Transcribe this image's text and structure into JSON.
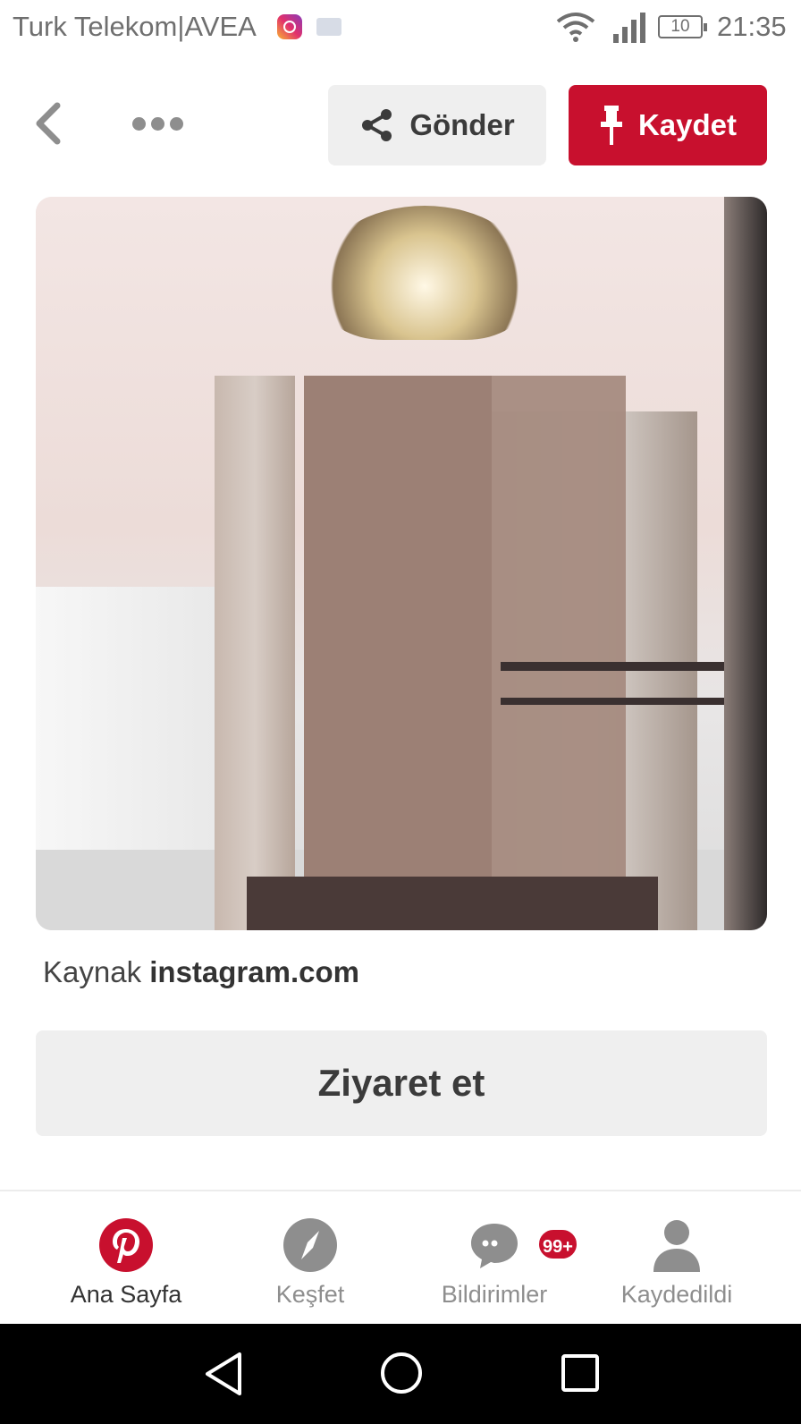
{
  "status_bar": {
    "carrier": "Turk Telekom|AVEA",
    "battery": "10",
    "time": "21:35",
    "icons": [
      "instagram-icon",
      "mail-icon",
      "wifi-icon",
      "signal-icon",
      "battery-icon"
    ]
  },
  "toolbar": {
    "back_icon": "chevron-left-icon",
    "more_icon": "more-horizontal-icon",
    "send_label": "Gönder",
    "send_icon": "share-icon",
    "save_label": "Kaydet",
    "save_icon": "pin-icon"
  },
  "pin": {
    "source_prefix": "Kaynak",
    "source_domain": "instagram.com",
    "visit_label": "Ziyaret et"
  },
  "bottom_nav": {
    "items": [
      {
        "label": "Ana Sayfa",
        "icon": "pinterest-icon",
        "active": true
      },
      {
        "label": "Keşfet",
        "icon": "compass-icon",
        "active": false
      },
      {
        "label": "Bildirimler",
        "icon": "chat-bubble-icon",
        "active": false,
        "badge": "99+"
      },
      {
        "label": "Kaydedildi",
        "icon": "person-icon",
        "active": false
      }
    ]
  },
  "android_nav": {
    "icons": [
      "back-triangle-icon",
      "home-circle-icon",
      "recents-square-icon"
    ]
  },
  "colors": {
    "accent": "#c8102e",
    "button_bg": "#efefef",
    "text_dark": "#333333",
    "text_muted": "#8e8e8e"
  }
}
